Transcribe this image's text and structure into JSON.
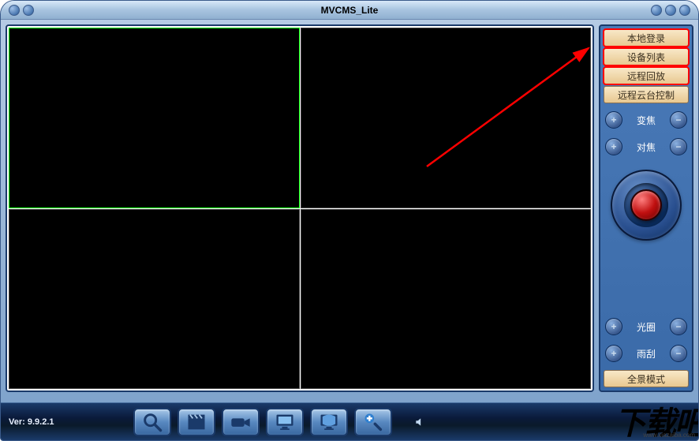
{
  "titlebar": {
    "title": "MVCMS_Lite"
  },
  "right_panel": {
    "buttons": [
      {
        "label": "本地登录",
        "highlighted": true
      },
      {
        "label": "设备列表",
        "highlighted": true
      },
      {
        "label": "远程回放",
        "highlighted": true
      },
      {
        "label": "远程云台控制",
        "highlighted": false
      }
    ],
    "ptz": {
      "zoom_label": "变焦",
      "focus_label": "对焦",
      "iris_label": "光圈",
      "wiper_label": "雨刮"
    },
    "panorama": "全景模式"
  },
  "bottom_bar": {
    "version": "Ver: 9.9.2.1"
  },
  "watermark": {
    "text": "下载吧",
    "url": "www.xiazaiba.com"
  }
}
